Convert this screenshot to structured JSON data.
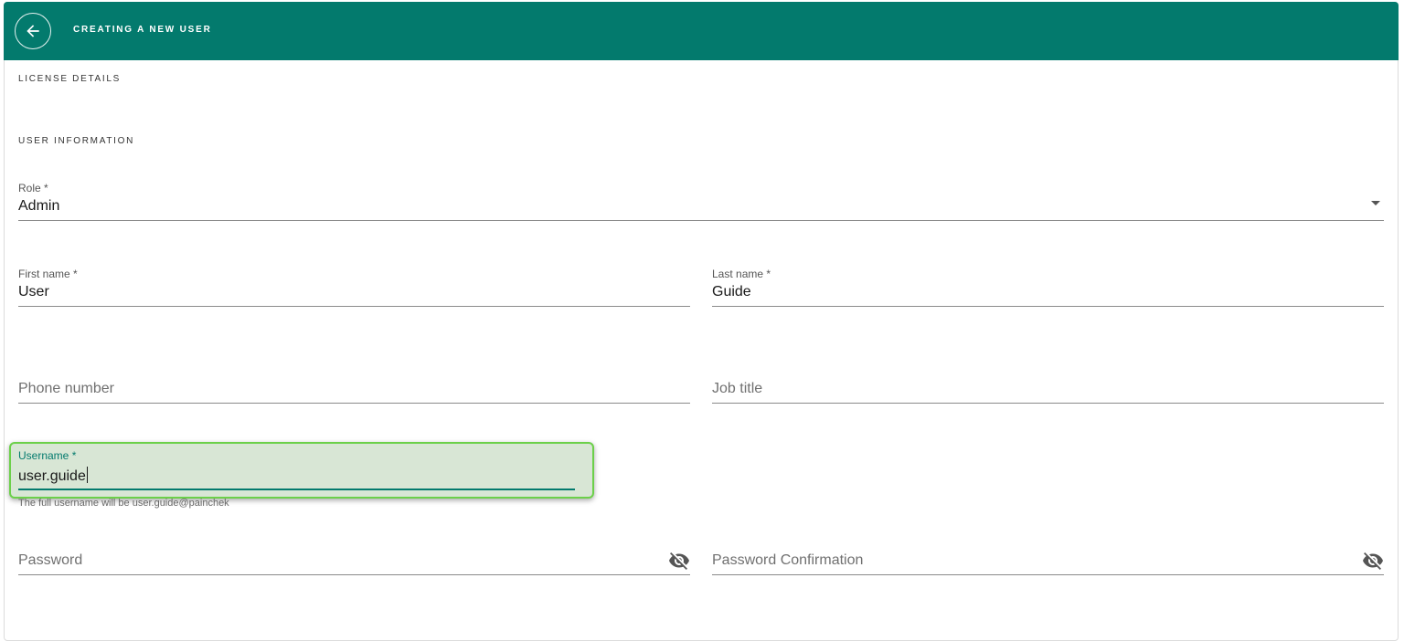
{
  "header": {
    "title": "CREATING A NEW USER"
  },
  "sections": {
    "license": "LICENSE DETAILS",
    "user_info": "USER INFORMATION"
  },
  "form": {
    "role": {
      "label": "Role *",
      "value": "Admin"
    },
    "first_name": {
      "label": "First name *",
      "value": "User"
    },
    "last_name": {
      "label": "Last name *",
      "value": "Guide"
    },
    "phone": {
      "placeholder": "Phone number"
    },
    "job_title": {
      "placeholder": "Job title"
    },
    "username": {
      "label": "Username *",
      "value": "user.guide",
      "hint": "The full username will be user.guide@painchek"
    },
    "password": {
      "placeholder": "Password"
    },
    "password_confirmation": {
      "placeholder": "Password Confirmation"
    }
  },
  "colors": {
    "header_bg": "#037a6d",
    "focus_accent": "#037a6d",
    "highlight_border": "#6cd04a",
    "highlight_fill": "#d8e6d5"
  },
  "icons": [
    "arrow-left-icon",
    "caret-down-icon",
    "eye-off-icon"
  ]
}
